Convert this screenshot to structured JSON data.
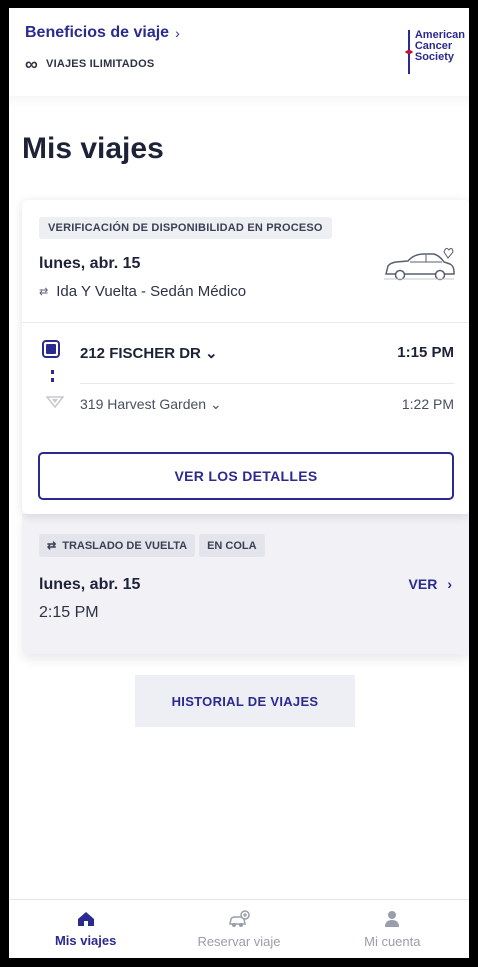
{
  "header": {
    "benefits_label": "Beneficios de viaje",
    "unlimited_label": "VIAJES ILIMITADOS",
    "logo_lines": [
      "American",
      "Cancer",
      "Society"
    ]
  },
  "page_title": "Mis viajes",
  "trip": {
    "status_badge": "VERIFICACIÓN DE DISPONIBILIDAD EN PROCESO",
    "date": "lunes, abr. 15",
    "trip_type": "Ida Y Vuelta - Sedán Médico",
    "pickup": {
      "address": "212 FISCHER DR",
      "time": "1:15 PM"
    },
    "dropoff": {
      "address": "319 Harvest Garden",
      "time": "1:22 PM"
    },
    "details_button": "VER LOS DETALLES"
  },
  "return_trip": {
    "badge_type": "TRASLADO DE VUELTA",
    "badge_status": "EN COLA",
    "date": "lunes, abr. 15",
    "time": "2:15 PM",
    "view_label": "VER"
  },
  "history_button": "HISTORIAL DE VIAJES",
  "tabs": [
    {
      "label": "Mis viajes",
      "icon": "home-icon",
      "active": true
    },
    {
      "label": "Reservar viaje",
      "icon": "car-add-icon",
      "active": false
    },
    {
      "label": "Mi cuenta",
      "icon": "person-icon",
      "active": false
    }
  ],
  "colors": {
    "accent": "#2b2a8f",
    "logo_red": "#c8102e"
  }
}
